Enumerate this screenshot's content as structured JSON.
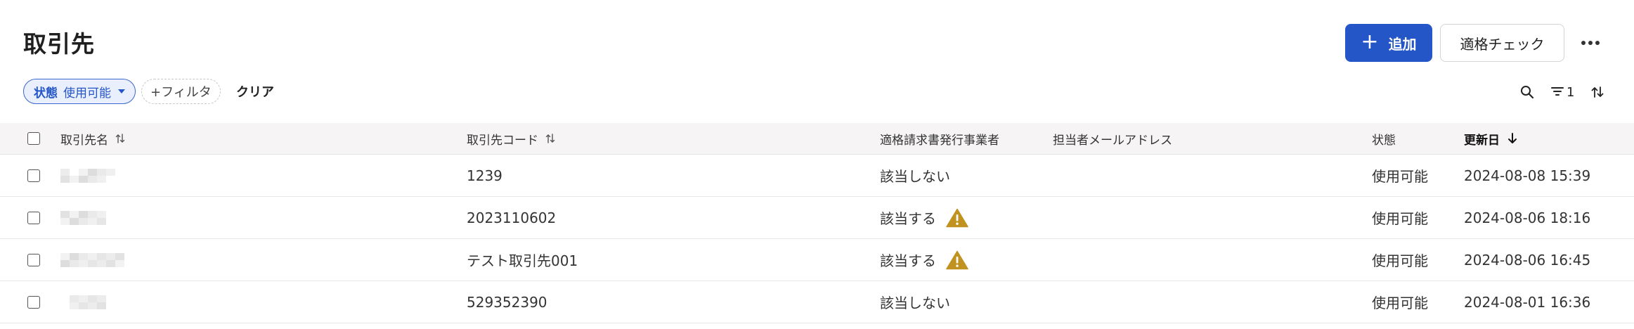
{
  "header": {
    "title": "取引先",
    "add_button": {
      "icon": "plus-icon",
      "label": "追加"
    },
    "check_button": {
      "label": "適格チェック"
    },
    "more_button": {
      "icon": "more-horizontal-icon"
    }
  },
  "filters": {
    "status_chip": {
      "key": "状態",
      "value": "使用可能",
      "icon": "caret-down-icon"
    },
    "add_filter": "+フィルタ",
    "clear": "クリア"
  },
  "toolbar": {
    "search_icon": "search-icon",
    "filter_icon": "filter-lines-icon",
    "filter_count": "1",
    "sort_icon": "sort-arrows-icon"
  },
  "table": {
    "columns": {
      "name": "取引先名",
      "code": "取引先コード",
      "qualified": "適格請求書発行事業者",
      "email": "担当者メールアドレス",
      "status": "状態",
      "updated": "更新日"
    },
    "rows": [
      {
        "name": "",
        "code": "1239",
        "qualified": "該当しない",
        "warning": false,
        "email": "",
        "status": "使用可能",
        "updated": "2024-08-08 15:39"
      },
      {
        "name": "",
        "code": "2023110602",
        "qualified": "該当する",
        "warning": true,
        "email": "",
        "status": "使用可能",
        "updated": "2024-08-06 18:16"
      },
      {
        "name": "",
        "code": "テスト取引先001",
        "qualified": "該当する",
        "warning": true,
        "email": "",
        "status": "使用可能",
        "updated": "2024-08-06 16:45"
      },
      {
        "name": "",
        "code": "529352390",
        "qualified": "該当しない",
        "warning": false,
        "email": "",
        "status": "使用可能",
        "updated": "2024-08-01 16:36"
      }
    ]
  },
  "colors": {
    "primary": "#2456c8",
    "chip_bg": "#e9effc",
    "header_bg": "#f6f4f4",
    "warning": "#c1921f"
  }
}
